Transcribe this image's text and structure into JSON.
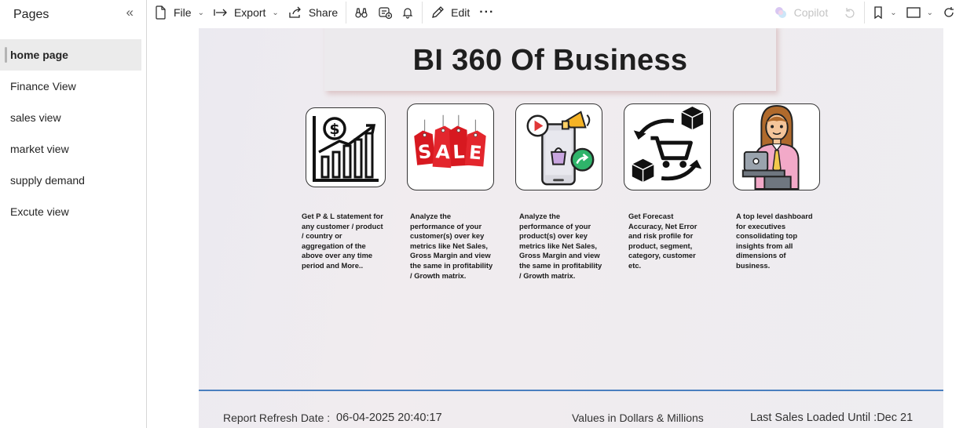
{
  "sidebar": {
    "title": "Pages",
    "collapse_icon": "double-chevron-left-icon",
    "pages": [
      {
        "label": "home page",
        "active": true
      },
      {
        "label": "Finance View",
        "active": false
      },
      {
        "label": "sales view",
        "active": false
      },
      {
        "label": "market view",
        "active": false
      },
      {
        "label": "supply demand",
        "active": false
      },
      {
        "label": "Excute view",
        "active": false
      }
    ]
  },
  "toolbar": {
    "file_label": "File",
    "export_label": "Export",
    "share_label": "Share",
    "edit_label": "Edit",
    "more_label": "···",
    "copilot_label": "Copilot"
  },
  "report": {
    "title": "BI 360 Of Business",
    "cards": [
      {
        "icon": "profit-chart-icon",
        "description": "Get  P & L statement for any customer / product / country or aggregation of the above over any time period and More.."
      },
      {
        "icon": "sale-tags-icon",
        "description": "Analyze the performance of your customer(s) over key metrics like Net Sales, Gross Margin and view the same in profitability / Growth matrix."
      },
      {
        "icon": "mobile-marketing-icon",
        "description": "Analyze the performance of your product(s) over key metrics like Net Sales, Gross Margin and view the same in profitability / Growth matrix."
      },
      {
        "icon": "supply-chain-cart-icon",
        "description": "Get Forecast Accuracy, Net Error and risk profile for product, segment, category, customer etc."
      },
      {
        "icon": "executive-woman-icon",
        "description": "A top level dashboard for executives consolidating top insights from all dimensions of business."
      }
    ],
    "footer": {
      "refresh_label": "Report Refresh Date :",
      "refresh_value": "06-04-2025 20:40:17",
      "units": "Values in Dollars & Millions",
      "last_loaded": "Last Sales Loaded Until :Dec 21"
    }
  },
  "colors": {
    "accent_line": "#4a7fbf",
    "sale_red": "#d71920",
    "title_shadow": "#e0a0a0"
  }
}
